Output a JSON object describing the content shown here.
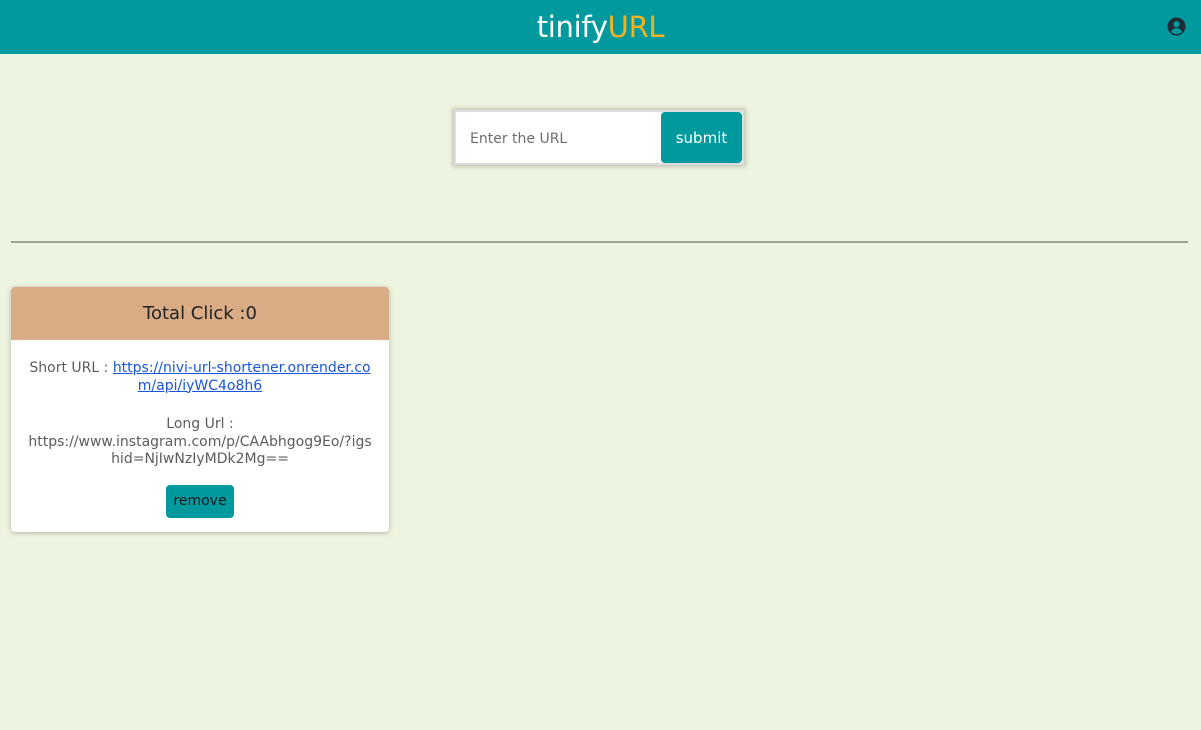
{
  "navbar": {
    "brand_main": "tinify",
    "brand_accent": "URL",
    "user_icon": "user-circle-icon"
  },
  "form": {
    "placeholder": "Enter the URL",
    "value": "",
    "submit_label": "submit"
  },
  "cards": [
    {
      "header": "Total Click :0",
      "short_label": "Short URL : ",
      "short_url": "https://nivi-url-shortener.onrender.com/api/iyWC4o8h6",
      "long_label": "Long Url :",
      "long_url": "https://www.instagram.com/p/CAAbhgog9Eo/?igshid=NjIwNzIyMDk2Mg==",
      "remove_label": "remove"
    }
  ],
  "colors": {
    "primary": "#009a9e",
    "accent": "#f0b323",
    "background": "#edf4df",
    "card_header": "#d9ac86",
    "link": "#1a56d6"
  }
}
